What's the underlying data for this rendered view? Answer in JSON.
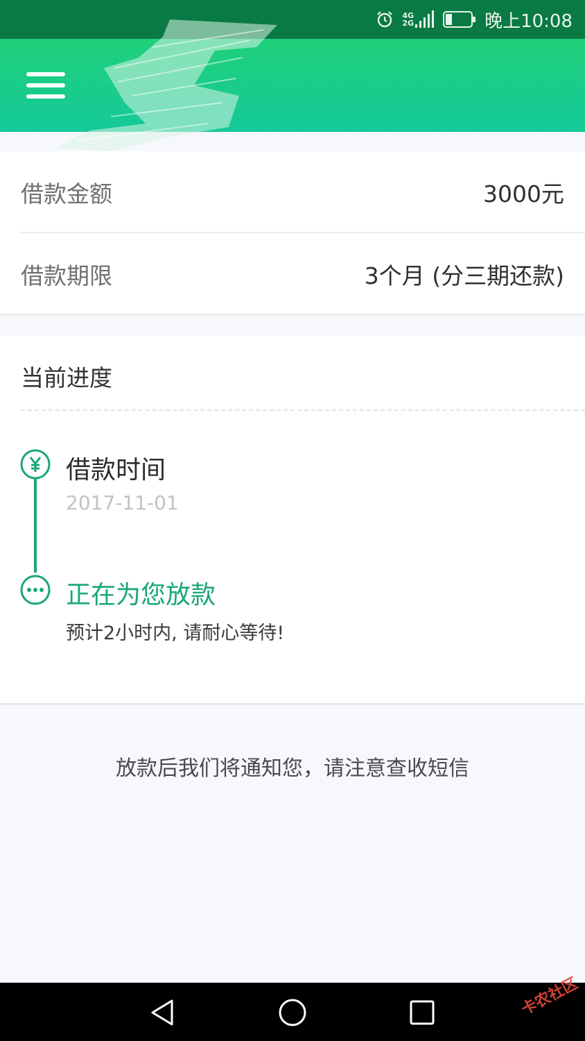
{
  "status_bar": {
    "network_top": "4G",
    "network_bottom": "2G",
    "time": "晚上10:08",
    "icons": [
      "alarm-icon",
      "signal-icon",
      "battery-icon"
    ]
  },
  "header": {
    "menu_icon": "hamburger-menu-icon"
  },
  "loan": {
    "amount_label": "借款金额",
    "amount_value": "3000元",
    "term_label": "借款期限",
    "term_value": "3个月 (分三期还款)"
  },
  "progress": {
    "title": "当前进度",
    "steps": [
      {
        "icon": "yuan-icon",
        "title": "借款时间",
        "detail": "2017-11-01"
      },
      {
        "icon": "ellipsis-icon",
        "title": "正在为您放款",
        "detail": "预计2小时内, 请耐心等待!"
      }
    ]
  },
  "notice": "放款后我们将通知您，请注意查收短信",
  "nav_bar": {
    "icons": [
      "back-triangle-icon",
      "home-circle-icon",
      "recents-square-icon"
    ]
  },
  "watermark": "卡农社区",
  "colors": {
    "status_bar": "#0a7a45",
    "header_top": "#1fd07a",
    "header_bottom": "#15c99a",
    "accent": "#1aa67a"
  }
}
